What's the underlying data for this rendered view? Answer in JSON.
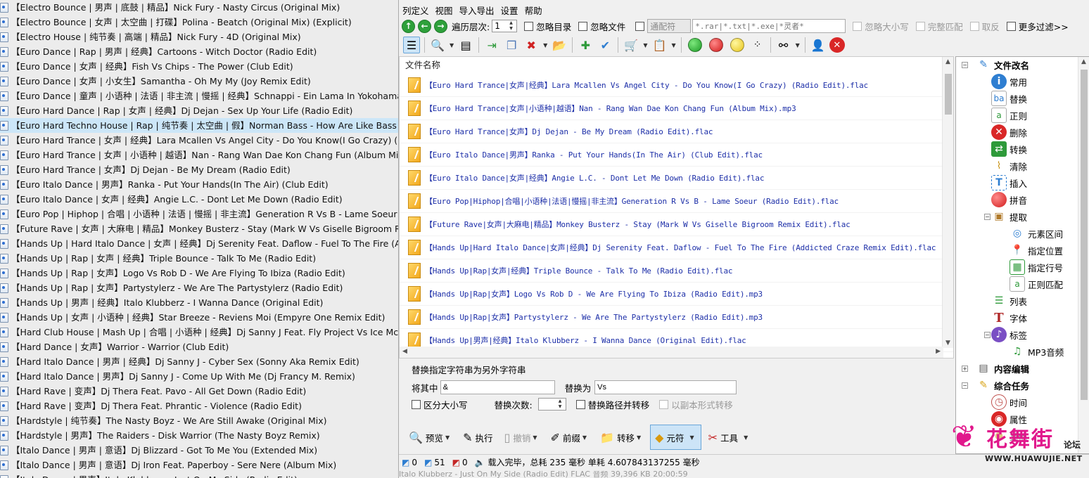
{
  "left_list": [
    "【Electro Bounce | 男声 | 底鼓 | 精品】Nick Fury - Nasty Circus (Original Mix)",
    "【Electro Bounce | 女声 | 太空曲 | 打碟】Polina - Beatch (Original Mix) (Explicit)",
    "【Electro House | 纯节奏 | 高端 | 精品】Nick Fury - 4D (Original Mix)",
    "【Euro Dance | Rap | 男声 | 经典】Cartoons - Witch Doctor (Radio Edit)",
    "【Euro Dance | 女声 | 经典】Fish Vs Chips - The Power (Club Edit)",
    "【Euro Dance | 女声 | 小女生】Samantha - Oh My My (Joy Remix Edit)",
    "【Euro Dance | 童声 | 小语种 | 法语 | 非主流 | 慢摇 | 经典】Schnappi - Ein Lama In Yokohama (Po",
    "【Euro Hard Dance | Rap | 女声 | 经典】Dj Dejan - Sex Up Your Life (Radio Edit)",
    "【Euro Hard Techno House | Rap | 纯节奏 | 太空曲 | 假】Norman Bass - How Are Like Bass (Or",
    "【Euro Hard Trance | 女声 | 经典】Lara Mcallen Vs Angel City - Do You Know(I Go Crazy) (Radi",
    "【Euro Hard Trance | 女声 | 小语种 | 越语】Nan - Rang Wan Dae Kon Chang Fun (Album Mix)",
    "【Euro Hard Trance | 女声】Dj Dejan - Be My Dream (Radio Edit)",
    "【Euro Italo Dance | 男声】Ranka - Put Your Hands(In The Air) (Club Edit)",
    "【Euro Italo Dance | 女声 | 经典】Angie L.C. - Dont Let Me Down (Radio Edit)",
    "【Euro Pop | Hiphop | 合唱 | 小语种 | 法语 | 慢摇 | 非主流】Generation R Vs B - Lame Soeur (Ra",
    "【Future Rave | 女声 | 大麻电 | 精品】Monkey Busterz - Stay (Mark W Vs Giselle Bigroom Remix",
    "【Hands Up | Hard Italo Dance | 女声 | 经典】Dj Serenity Feat. Daflow - Fuel To The Fire (Addic",
    "【Hands Up | Rap | 女声 | 经典】Triple Bounce - Talk To Me (Radio Edit)",
    "【Hands Up | Rap | 女声】Logo Vs Rob D - We Are Flying To Ibiza (Radio Edit)",
    "【Hands Up | Rap | 女声】Partystylerz - We Are The Partystylerz (Radio Edit)",
    "【Hands Up | 男声 | 经典】Italo Klubberz - I Wanna Dance (Original Edit)",
    "【Hands Up | 女声 | 小语种 | 经典】Star Breeze - Reviens Moi (Empyre One Remix Edit)",
    "【Hard Club House | Mash Up | 合唱 | 小语种 | 经典】Dj Sanny J Feat. Fly Project Vs Ice Mc - Ra",
    "【Hard Dance | 女声】Warrior - Warrior (Club Edit)",
    "【Hard Italo Dance | 男声 | 经典】Dj Sanny J - Cyber Sex (Sonny Aka Remix Edit)",
    "【Hard Italo Dance | 男声】Dj Sanny J - Come Up With Me (Dj Francy M. Remix)",
    "【Hard Rave | 变声】Dj Thera Feat. Pavo - All Get Down (Radio Edit)",
    "【Hard Rave | 变声】Dj Thera Feat. Phrantic - Violence (Radio Edit)",
    "【Hardstyle | 纯节奏】The Nasty Boyz - We Are Still Awake (Original Mix)",
    "【Hardstyle | 男声】The Raiders - Disk Warrior (The Nasty Boyz Remix)",
    "【Italo Dance | 男声 | 意语】Dj Blizzard - Got To Me You (Extended Mix)",
    "【Italo Dance | 男声 | 意语】Dj Iron Feat. Paperboy - Sere Nere (Album Mix)",
    "【Italo Dance | 男声】Italo Klubberz - Just On My Side (Radio Edit)"
  ],
  "left_selected_index": 8,
  "menu": [
    "列定义",
    "视图",
    "导入导出",
    "设置",
    "帮助"
  ],
  "nav": {
    "depth_label": "遍历层次:",
    "depth_value": "1",
    "ignore_dir": "忽略目录",
    "ignore_file": "忽略文件",
    "wildcard_label": "通配符",
    "filter_text": "*.rar|*.txt|*.exe|*灵者*",
    "ignore_case": "忽略大小写",
    "full_match": "完整匹配",
    "invert": "取反",
    "more_filter": "更多过滤>>"
  },
  "filelist": {
    "header": "文件名称",
    "files": [
      "【Euro Hard Trance|女声|经典】Lara Mcallen Vs Angel City - Do You Know(I Go Crazy) (Radio Edit).flac",
      "【Euro Hard Trance|女声|小语种|越语】Nan - Rang Wan Dae Kon Chang Fun (Album Mix).mp3",
      "【Euro Hard Trance|女声】Dj Dejan - Be My Dream (Radio Edit).flac",
      "【Euro Italo Dance|男声】Ranka - Put Your Hands(In The Air) (Club Edit).flac",
      "【Euro Italo Dance|女声|经典】Angie L.C. - Dont Let Me Down (Radio Edit).flac",
      "【Euro Pop|Hiphop|合唱|小语种|法语|慢摇|非主流】Generation R Vs B - Lame Soeur (Radio Edit).flac",
      "【Future Rave|女声|大麻电|精品】Monkey Busterz - Stay (Mark W Vs Giselle Bigroom Remix Edit).flac",
      "【Hands Up|Hard Italo Dance|女声|经典】Dj Serenity Feat. Daflow - Fuel To The Fire (Addicted Craze Remix Edit).flac",
      "【Hands Up|Rap|女声|经典】Triple Bounce - Talk To Me (Radio Edit).flac",
      "【Hands Up|Rap|女声】Logo Vs Rob D - We Are Flying To Ibiza (Radio Edit).mp3",
      "【Hands Up|Rap|女声】Partystylerz - We Are The Partystylerz (Radio Edit).mp3",
      "【Hands Up|男声|经典】Italo Klubberz - I Wanna Dance (Original Edit).flac"
    ]
  },
  "replace_panel": {
    "title": "替换指定字符串为另外字符串",
    "find_label": "将其中",
    "find_value": "&",
    "replace_label": "替换为",
    "replace_value": "Vs",
    "case_label": "区分大小写",
    "count_label": "替换次数:",
    "path_label": "替换路径并转移",
    "copy_label": "以副本形式转移"
  },
  "bottom_buttons": {
    "preview": "预览",
    "execute": "执行",
    "undo": "撤销",
    "prefix": "前缀",
    "move": "转移",
    "meta": "元符",
    "tools": "工具"
  },
  "status": {
    "count1": "0",
    "count2": "51",
    "count3": "0",
    "message": "载入完毕，总耗 235 毫秒 单耗 4.607843137255 毫秒"
  },
  "ghost_row": "Italo Klubberz - Just On My Side (Radio Edit)          FLAC 音频          39,396 KB    20:00:59",
  "tree": {
    "root": "文件改名",
    "items": {
      "common": "常用",
      "replace": "替换",
      "regex": "正则",
      "delete": "删除",
      "convert": "转换",
      "clear": "清除",
      "insert": "插入",
      "pinyin": "拼音",
      "extract": "提取",
      "element_range": "元素区间",
      "position": "指定位置",
      "line_no": "指定行号",
      "regex_match": "正则匹配",
      "list": "列表",
      "font": "字体",
      "tag": "标签",
      "mp3": "MP3音频",
      "content_edit": "内容编辑",
      "tasks": "综合任务",
      "time": "时间",
      "attr": "属性",
      "other": "其他"
    }
  },
  "watermark": {
    "cn": "花舞街",
    "sub": "论坛",
    "url": "WWW.HUAWUJIE.NET"
  },
  "colors": {
    "accent": "#1d2fa8",
    "selection": "#cce6f8",
    "watermark": "#e1188c"
  }
}
